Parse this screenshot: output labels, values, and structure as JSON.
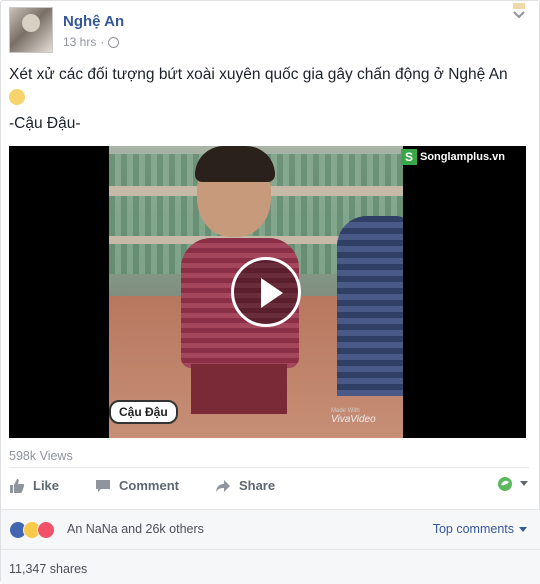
{
  "post": {
    "page_name": "Nghệ An",
    "time": "13 hrs",
    "privacy_icon": "globe-icon",
    "text": "Xét xử các đối tượng bứt xoài xuyên quốc gia gây chấn động ở Nghệ An",
    "signature": "-Cậu Đậu-"
  },
  "video": {
    "watermark": "Songlamplus.vn",
    "caption_tag": "Cậu Đậu",
    "made_with": "Made With",
    "viva": "VivaVideo",
    "views": "598k Views"
  },
  "actions": {
    "like": "Like",
    "comment": "Comment",
    "share": "Share"
  },
  "reactions": {
    "summary": "An NaNa and 26k others",
    "top_comments": "Top comments",
    "shares": "11,347 shares"
  },
  "colors": {
    "link": "#365899",
    "like_blue": "#4267b2",
    "haha_yellow": "#f7c94b",
    "love_red": "#f25268"
  }
}
